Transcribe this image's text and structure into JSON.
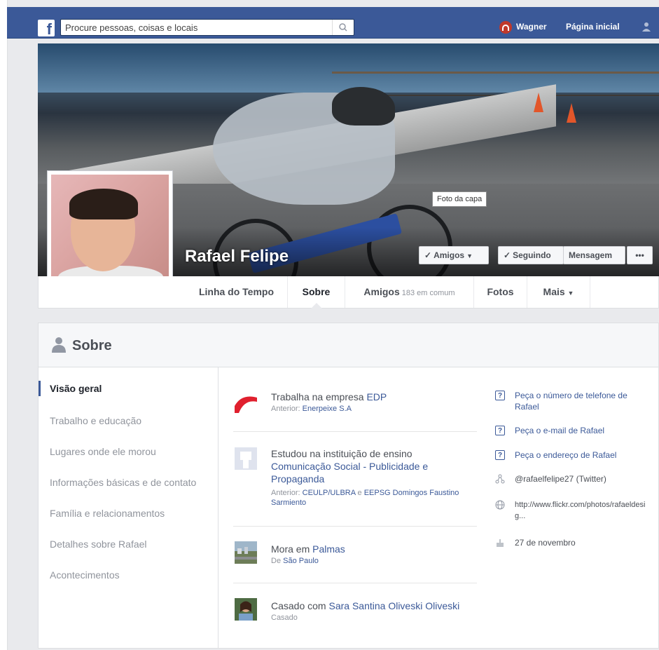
{
  "topbar": {
    "search_placeholder": "Procure pessoas, coisas e locais",
    "user_name": "Wagner",
    "home_label": "Página inicial"
  },
  "cover": {
    "tooltip": "Foto da capa",
    "name": "Rafael Felipe"
  },
  "actions": {
    "friends": "Amigos",
    "following": "Seguindo",
    "message": "Mensagem",
    "more": "•••"
  },
  "timeline_nav": {
    "items": [
      {
        "label": "Linha do Tempo"
      },
      {
        "label": "Sobre"
      },
      {
        "label": "Amigos",
        "sub": "183 em comum"
      },
      {
        "label": "Fotos"
      },
      {
        "label": "Mais"
      }
    ]
  },
  "about": {
    "title": "Sobre",
    "side_items": [
      "Visão geral",
      "Trabalho e educação",
      "Lugares onde ele morou",
      "Informações básicas e de contato",
      "Família e relacionamentos",
      "Detalhes sobre Rafael",
      "Acontecimentos"
    ],
    "entries": [
      {
        "main_prefix": "Trabalha na empresa ",
        "main_link": "EDP",
        "sub_prefix": "Anterior: ",
        "sub_link": "Enerpeixe S.A"
      },
      {
        "main_prefix": "Estudou na instituição de ensino ",
        "main_link": "Comunicação Social - Publicidade e Propaganda",
        "sub_prefix": "Anterior: ",
        "sub_link": "CEULP/ULBRA",
        "sub_mid": " e ",
        "sub_link2": "EEPSG Domingos Faustino Sarmiento"
      },
      {
        "main_prefix": "Mora em ",
        "main_link": "Palmas",
        "sub_prefix": "De ",
        "sub_link": "São Paulo"
      },
      {
        "main_prefix": "Casado com ",
        "main_link": "Sara Santina Oliveski Oliveski",
        "sub_prefix": "Casado"
      }
    ],
    "contact": {
      "phone": "Peça o número de telefone de Rafael",
      "email": "Peça o e-mail de Rafael",
      "address": "Peça o endereço de Rafael",
      "twitter_handle": "@rafaelfelipe27",
      "twitter_suffix": " (Twitter)",
      "website": "http://www.flickr.com/photos/rafaeldesig...",
      "birthday": "27 de novembro"
    }
  },
  "colors": {
    "brand": "#3b5998",
    "text_gray": "#90949c"
  }
}
